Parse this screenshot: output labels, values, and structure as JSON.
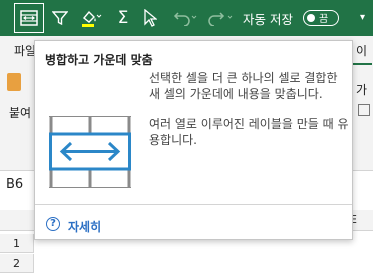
{
  "titlebar": {
    "autosave_label": "자동 저장",
    "autosave_state": "끔",
    "accent_color": "#217346"
  },
  "quick_access": {
    "icons": [
      "merge-center-icon",
      "filter-icon",
      "fill-color-icon",
      "sum-icon",
      "select-cursor-icon",
      "undo-icon",
      "redo-icon"
    ]
  },
  "ribbon": {
    "file_tab": "파일",
    "visible_tab_fragment": "이",
    "paste_label": "붙여",
    "right_fragment": "가"
  },
  "formula_bar": {
    "name_box": "B6"
  },
  "grid": {
    "visible_column": "E",
    "rows": [
      "1",
      "2"
    ]
  },
  "tooltip": {
    "title": "병합하고 가운데 맞춤",
    "description": [
      "선택한 셀을 더 큰 하나의 셀로 결합한 새 셀의 가운데에 내용을 맞춥니다.",
      "여러 열로 이루어진 레이블을 만들 때 유용합니다."
    ],
    "help_label": "자세히",
    "illustration_color": "#2b87c8"
  }
}
